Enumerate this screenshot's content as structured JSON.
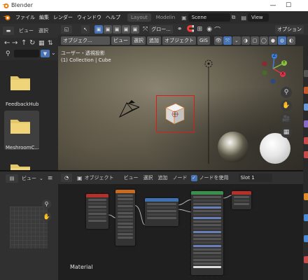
{
  "window": {
    "title": "Blender",
    "min": "—",
    "max": "☐"
  },
  "menu": {
    "items": [
      "ファイル",
      "編集",
      "レンダー",
      "ウィンドウ",
      "ヘルプ"
    ],
    "tabs": [
      "Layout",
      "Modelin"
    ],
    "scene": "Scene",
    "viewlayer": "View La"
  },
  "filebrowser": {
    "header": {
      "view": "ビュー",
      "select": "選択"
    },
    "folders": [
      "FeedbackHub",
      "MeshroomC..."
    ]
  },
  "viewport": {
    "header": {
      "mode": "オブジェク...",
      "view": "ビュー",
      "select": "選択",
      "add": "追加",
      "object": "オブジェクト",
      "gis": "GIS"
    },
    "toolbar": {
      "global": "グロー...",
      "options": "オプション"
    },
    "overlay_line1": "ユーザー・透視投影",
    "overlay_line2": "(1) Collection | Cube",
    "gizmo": {
      "x": "X",
      "y": "Y",
      "z": "Z"
    }
  },
  "image_editor": {
    "view": "ビュー"
  },
  "node_editor": {
    "header": {
      "mode": "オブジェクト",
      "view": "ビュー",
      "select": "選択",
      "add": "追加",
      "node": "ノード",
      "use_nodes": "ノードを使用",
      "slot": "Slot 1"
    },
    "label": "Material"
  },
  "colors": {
    "accent": "#4772b3",
    "select_box": "#e01a1a",
    "node_green": "#3a8f4a",
    "node_red": "#b5302a",
    "node_orange": "#c96a1e",
    "node_blue": "#3f70b0"
  }
}
